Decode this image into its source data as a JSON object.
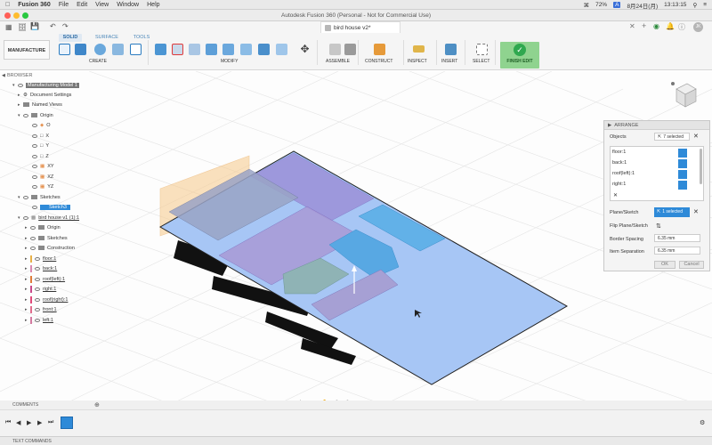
{
  "menubar": {
    "app": "Fusion 360",
    "items": [
      "File",
      "Edit",
      "View",
      "Window",
      "Help"
    ],
    "battery": "72%",
    "date": "8月24日(月)",
    "time": "13:13:15"
  },
  "window": {
    "title": "Autodesk Fusion 360 (Personal - Not for Commercial Use)",
    "doc_tab": "bird house v2*"
  },
  "ribbon": {
    "workspace": "MANUFACTURE",
    "tabs": [
      "SOLID",
      "SURFACE",
      "TOOLS"
    ],
    "groups": [
      "CREATE",
      "MODIFY",
      "ASSEMBLE",
      "CONSTRUCT",
      "INSPECT",
      "INSERT",
      "SELECT"
    ],
    "finish": "FINISH EDIT"
  },
  "browser": {
    "title": "BROWSER",
    "root": "Manufacturing Model 1",
    "rows": [
      {
        "label": "Document Settings"
      },
      {
        "label": "Named Views"
      },
      {
        "label": "Origin"
      },
      {
        "label": "O"
      },
      {
        "label": "X"
      },
      {
        "label": "Y"
      },
      {
        "label": "Z"
      },
      {
        "label": "XY"
      },
      {
        "label": "XZ"
      },
      {
        "label": "YZ"
      },
      {
        "label": "Sketches"
      },
      {
        "label": "Sketch3"
      },
      {
        "label": "bird house v1 (1):1"
      },
      {
        "label": "Origin"
      },
      {
        "label": "Sketches"
      },
      {
        "label": "Construction"
      },
      {
        "label": "floor:1"
      },
      {
        "label": "back:1"
      },
      {
        "label": "roof(left):1"
      },
      {
        "label": "right:1"
      },
      {
        "label": "roof(right):1"
      },
      {
        "label": "front:1"
      },
      {
        "label": "left:1"
      }
    ],
    "colors": [
      "#e8b048",
      "#d98ab0",
      "#e07c3a",
      "#c94a8a",
      "#e04a7a",
      "#e06c8c",
      "#d37aa0"
    ]
  },
  "arrange": {
    "title": "ARRANGE",
    "objects_label": "Objects",
    "objects_badge": "7 selected",
    "list": [
      "floor:1",
      "back:1",
      "roof(left):1",
      "right:1"
    ],
    "plane_label": "Plane/Sketch",
    "plane_badge": "1 selected",
    "flip_label": "Flip Plane/Sketch",
    "border_label": "Border Spacing",
    "border_value": "6.35 mm",
    "item_label": "Item Separation",
    "item_value": "6.35 mm",
    "ok": "OK",
    "cancel": "Cancel"
  },
  "bottom": {
    "comments": "COMMENTS",
    "text_commands": "TEXT COMMANDS"
  }
}
